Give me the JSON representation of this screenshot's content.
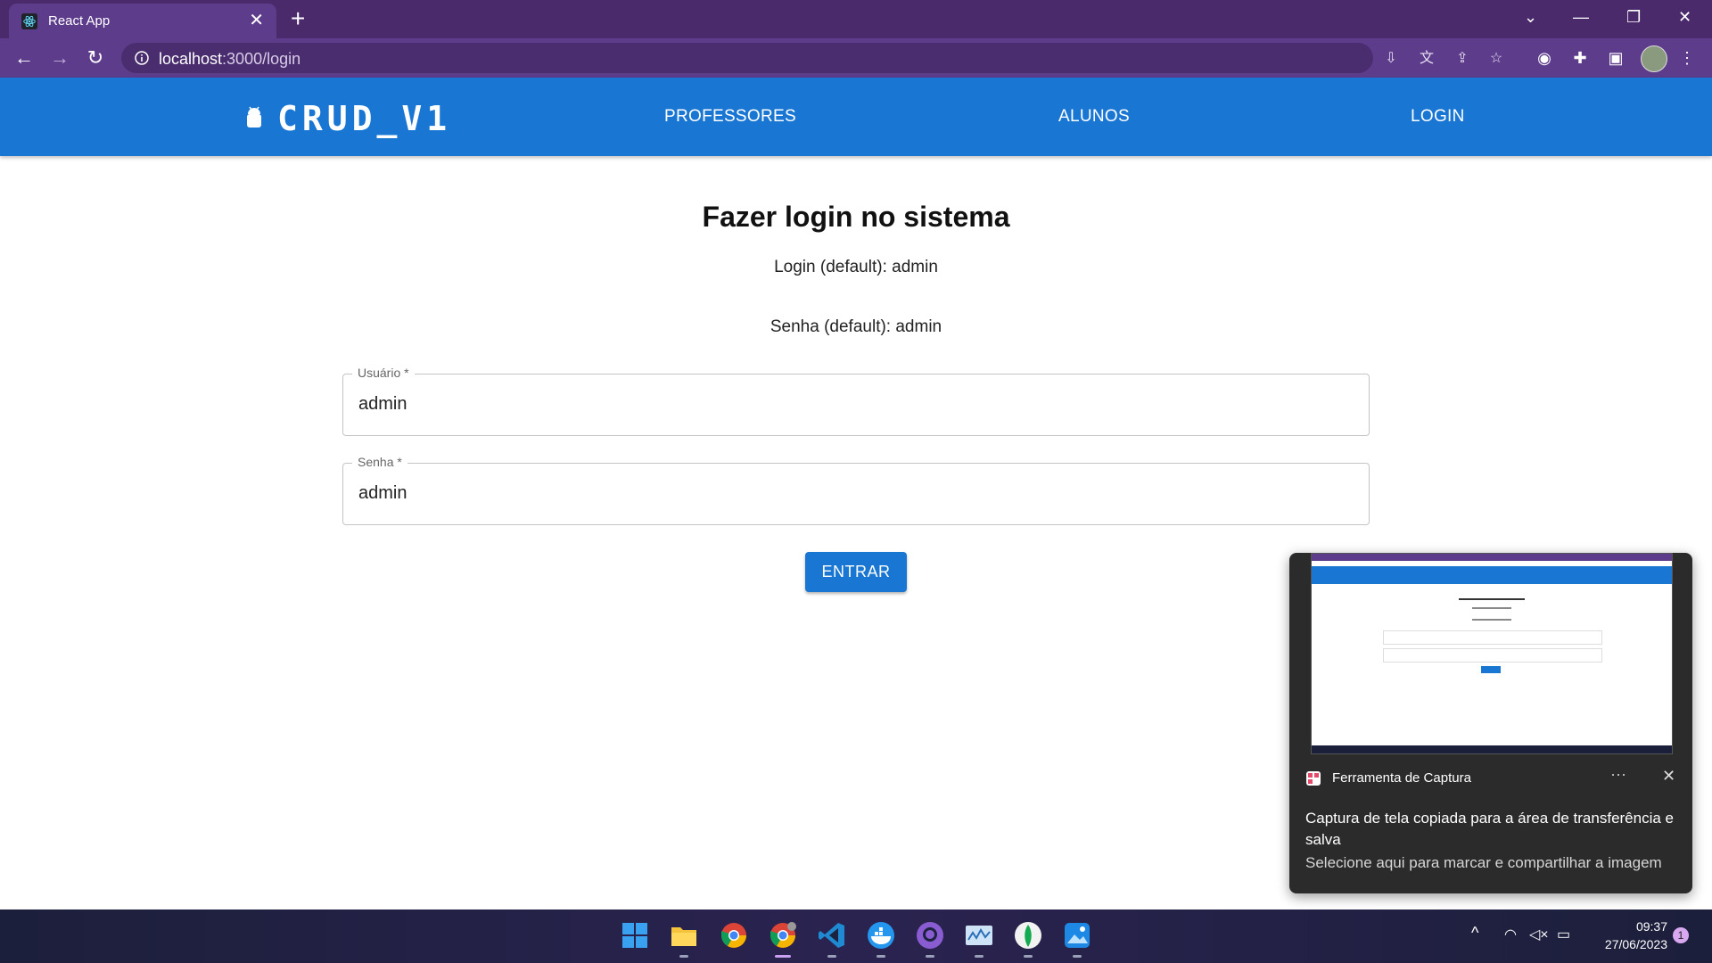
{
  "browser": {
    "tab_title": "React App",
    "url_host": "localhost",
    "url_rest": ":3000/login",
    "icons": [
      "react-icon",
      "close-icon",
      "plus-icon",
      "chevron-down-icon",
      "minimize-icon",
      "restore-icon",
      "close-window-icon",
      "back-arrow-icon",
      "forward-arrow-icon",
      "reload-icon",
      "info-icon",
      "install-icon",
      "translate-icon",
      "share-icon",
      "star-icon",
      "extension-icon",
      "puzzle-icon",
      "sidepanel-icon",
      "avatar",
      "kebab-menu-icon"
    ],
    "accent_color": "#5e3c8c"
  },
  "appbar": {
    "brand": "CRUD_V1",
    "nav": [
      "PROFESSORES",
      "ALUNOS",
      "LOGIN"
    ],
    "color": "#1976d2"
  },
  "login": {
    "title": "Fazer login no sistema",
    "hint_login": "Login (default): admin",
    "hint_password": "Senha (default): admin",
    "username_label": "Usuário *",
    "username_value": "admin",
    "password_label": "Senha *",
    "password_value": "admin",
    "submit_label": "ENTRAR"
  },
  "toast": {
    "app_name": "Ferramenta de Captura",
    "more": "···",
    "close": "✕",
    "message": "Captura de tela copiada para a área de transferência e salva",
    "sub": "Selecione aqui para marcar e compartilhar a imagem"
  },
  "taskbar": {
    "apps": [
      "windows-start",
      "file-explorer",
      "chrome",
      "chrome-dev",
      "vscode",
      "docker",
      "github-desktop",
      "resource-monitor",
      "mongodb-compass",
      "photos"
    ],
    "time": "09:37",
    "date": "27/06/2023",
    "notifications": "1"
  }
}
